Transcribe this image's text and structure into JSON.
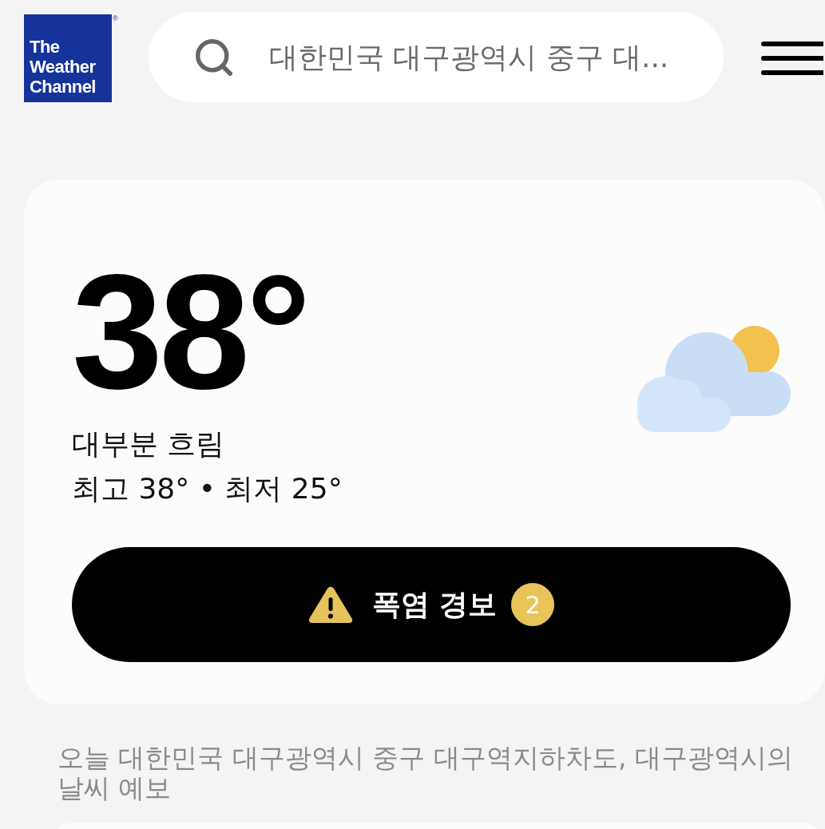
{
  "header": {
    "logo": {
      "lines": [
        "The",
        "Weather",
        "Channel"
      ],
      "mark": "®"
    },
    "search": {
      "placeholder": "대한민국 대구광역시 중구 대..."
    }
  },
  "current": {
    "temperature": "38°",
    "condition": "대부분 흐림",
    "high_low": "최고 38° • 최저 25°"
  },
  "alert_button": {
    "label": "폭염 경보",
    "count": "2"
  },
  "forecast_heading": "오늘 대한민국 대구광역시 중구 대구역지하차도, 대구광역시의 날씨 예보"
}
